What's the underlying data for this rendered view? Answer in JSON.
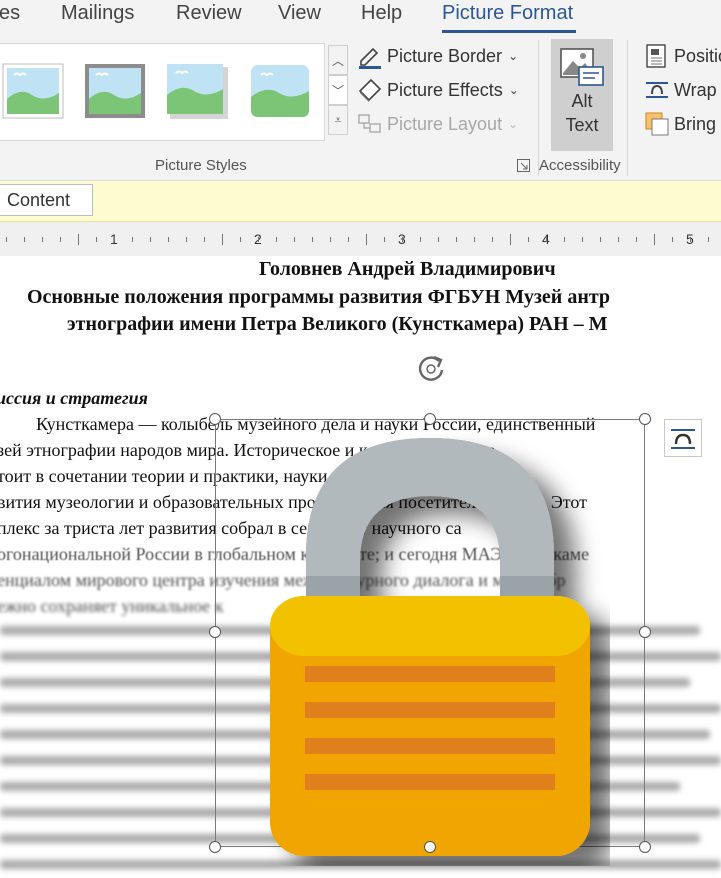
{
  "tabs": [
    {
      "label": "es"
    },
    {
      "label": "Mailings"
    },
    {
      "label": "Review"
    },
    {
      "label": "View"
    },
    {
      "label": "Help"
    },
    {
      "label": "Picture Format",
      "active": true
    }
  ],
  "ribbon": {
    "picture_border": "Picture Border",
    "picture_effects": "Picture Effects",
    "picture_layout": "Picture Layout",
    "picture_styles_label": "Picture Styles",
    "alt_text_line1": "Alt",
    "alt_text_line2": "Text",
    "accessibility_label": "Accessibility",
    "position": "Positio",
    "wrap_text": "Wrap T",
    "bring_forward": "Bring F"
  },
  "infobar": {
    "content_button": "Content"
  },
  "ruler": {
    "numbers": [
      "1",
      "2",
      "3",
      "4",
      "5"
    ]
  },
  "document": {
    "author": "Головнев Андрей Владимирович",
    "title_line1": "Основные положения программы развития ФГБУН Музей антр",
    "title_line2": "этнографии имени Петра Великого (Кунсткамера) РАН – М",
    "section_heading": "иссия и стратегия",
    "para_line1": "Кунсткамера — колыбель музейного дела и науки России, единственный",
    "para_line2": "зей этнографии народов мира. Историческое и конкурентное пре",
    "para_line3": "тоит в сочетании теории и практики, науки и всемирно извес",
    "para_line4": "вития музеологии и образовательных программ для посетителей музея. Этот",
    "para_line5": "плекс  за  триста  лет  развития  собрал  в  себе  опыт  научного  са",
    "para_line6": "огонациональной России в глобальном контексте; и сегодня МАЭ-Кунсткаме",
    "para_line7": "енциалом мирового центра изучения межкультурного диалога и многообр",
    "para_line8": "ежно сохраняет уникальное к"
  },
  "colors": {
    "accent": "#2b5797",
    "infobar": "#fdfbd0",
    "lock_body": "#f0a500",
    "lock_shackle": "#9aa3a8",
    "lock_stripes": "#e0801a"
  }
}
